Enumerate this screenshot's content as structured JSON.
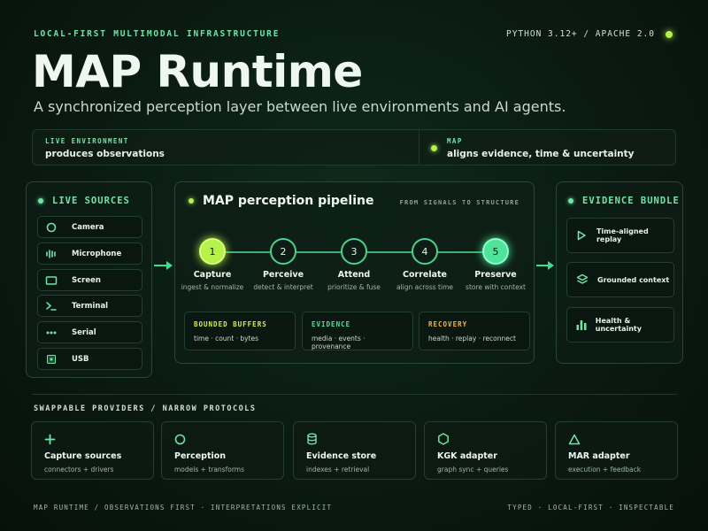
{
  "header": {
    "eyebrow": "LOCAL-FIRST MULTIMODAL INFRASTRUCTURE",
    "meta": "PYTHON 3.12+ / APACHE 2.0",
    "title": "MAP Runtime",
    "subtitle": "A synchronized perception layer between live environments and AI agents."
  },
  "infobar": {
    "left_kicker": "LIVE ENVIRONMENT",
    "left_text": "produces observations",
    "right_kicker": "MAP",
    "right_text": "aligns evidence, time & uncertainty"
  },
  "live_sources": {
    "title": "LIVE SOURCES",
    "items": [
      {
        "label": "Camera",
        "icon": "camera-icon"
      },
      {
        "label": "Microphone",
        "icon": "microphone-icon"
      },
      {
        "label": "Screen",
        "icon": "screen-icon"
      },
      {
        "label": "Terminal",
        "icon": "terminal-icon"
      },
      {
        "label": "Serial",
        "icon": "serial-icon"
      },
      {
        "label": "USB",
        "icon": "usb-icon"
      }
    ]
  },
  "pipeline": {
    "title": "MAP perception pipeline",
    "tag": "FROM SIGNALS TO STRUCTURE",
    "stages": [
      {
        "num": "1",
        "name": "Capture",
        "desc": "ingest & normalize"
      },
      {
        "num": "2",
        "name": "Perceive",
        "desc": "detect & interpret"
      },
      {
        "num": "3",
        "name": "Attend",
        "desc": "prioritize & fuse"
      },
      {
        "num": "4",
        "name": "Correlate",
        "desc": "align across time"
      },
      {
        "num": "5",
        "name": "Preserve",
        "desc": "store with context"
      }
    ],
    "cards": [
      {
        "kicker": "BOUNDED BUFFERS",
        "text": "time · count · bytes",
        "color": "#d4f24a"
      },
      {
        "kicker": "EVIDENCE",
        "text": "media · events · provenance",
        "color": "#4fe39b"
      },
      {
        "kicker": "RECOVERY",
        "text": "health · replay · reconnect",
        "color": "#f2b84a"
      }
    ]
  },
  "bundle": {
    "title": "EVIDENCE BUNDLE",
    "items": [
      {
        "label": "Time-aligned replay",
        "icon": "play-icon"
      },
      {
        "label": "Grounded context",
        "icon": "layers-icon"
      },
      {
        "label": "Health & uncertainty",
        "icon": "bar-chart-icon"
      }
    ]
  },
  "providers": {
    "title": "SWAPPABLE PROVIDERS / NARROW PROTOCOLS",
    "items": [
      {
        "name": "Capture sources",
        "desc": "connectors + drivers",
        "icon": "plus-icon"
      },
      {
        "name": "Perception",
        "desc": "models + transforms",
        "icon": "circle-icon"
      },
      {
        "name": "Evidence store",
        "desc": "indexes + retrieval",
        "icon": "database-icon"
      },
      {
        "name": "KGK adapter",
        "desc": "graph sync + queries",
        "icon": "hexagon-icon"
      },
      {
        "name": "MAR adapter",
        "desc": "execution + feedback",
        "icon": "triangle-icon"
      }
    ]
  },
  "footer": {
    "left": "MAP RUNTIME / OBSERVATIONS FIRST · INTERPRETATIONS EXPLICIT",
    "right": "TYPED · LOCAL-FIRST · INSPECTABLE"
  },
  "colors": {
    "accent": "#6fe6a8",
    "lime": "#b6f24a",
    "background": "#0a1a12"
  }
}
